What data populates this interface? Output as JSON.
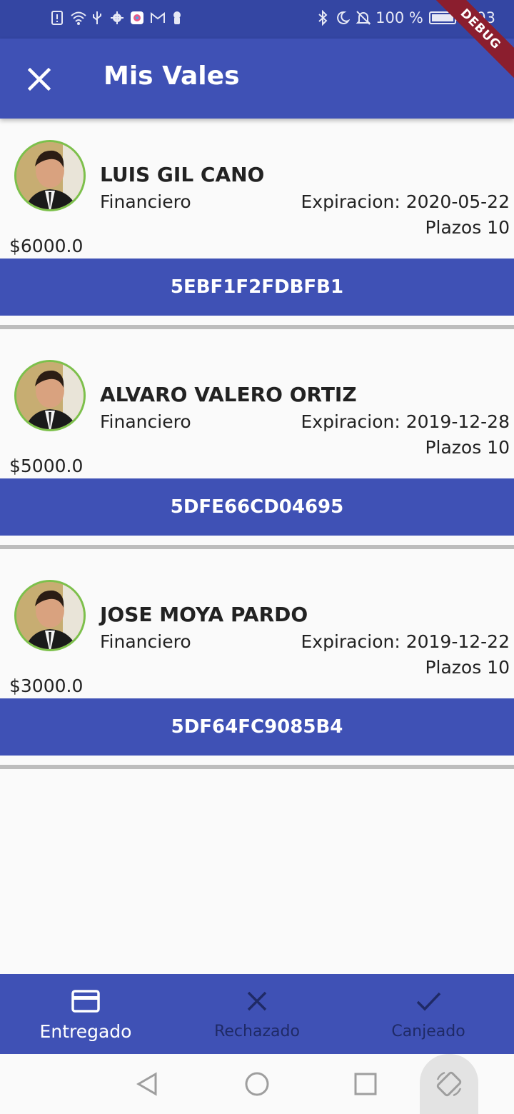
{
  "status_bar": {
    "battery_text": "100 %",
    "time": "9:03",
    "battery_level": 1.0,
    "left_icons": [
      "sim-alert-icon",
      "wifi-icon",
      "usb-icon",
      "settings-icon",
      "app-icon",
      "gmail-icon",
      "keyhole-icon"
    ],
    "right_icons": [
      "bluetooth-icon",
      "do-not-disturb-icon",
      "bell-off-icon",
      "battery-icon"
    ]
  },
  "debug_banner": "DEBUG",
  "app_bar": {
    "title": "Mis Vales",
    "close_icon": "close-icon",
    "background": "#3f51b5"
  },
  "vouchers": [
    {
      "name": "LUIS GIL CANO",
      "role": "Financiero",
      "expiry": "Expiracion: 2020-05-22",
      "terms": "Plazos 10",
      "amount": "$6000.0",
      "code": "5EBF1F2FDBFB1"
    },
    {
      "name": "ALVARO VALERO ORTIZ",
      "role": "Financiero",
      "expiry": "Expiracion: 2019-12-28",
      "terms": "Plazos 10",
      "amount": "$5000.0",
      "code": "5DFE66CD04695"
    },
    {
      "name": "JOSE MOYA PARDO",
      "role": "Financiero",
      "expiry": "Expiracion: 2019-12-22",
      "terms": "Plazos 10",
      "amount": "$3000.0",
      "code": "5DF64FC9085B4"
    }
  ],
  "bottom_nav": {
    "items": [
      {
        "label": "Entregado",
        "icon": "credit-card-icon",
        "active": true
      },
      {
        "label": "Rechazado",
        "icon": "close-icon",
        "active": false
      },
      {
        "label": "Canjeado",
        "icon": "check-icon",
        "active": false
      }
    ]
  },
  "system_nav": {
    "icons": [
      "back-icon",
      "home-icon",
      "recents-icon",
      "rotate-icon"
    ]
  },
  "colors": {
    "primary": "#3f51b5",
    "status_bar": "#3446a3",
    "avatar_ring": "#7cc04b",
    "divider": "#bdbdbd",
    "debug": "#8b1e2e"
  }
}
